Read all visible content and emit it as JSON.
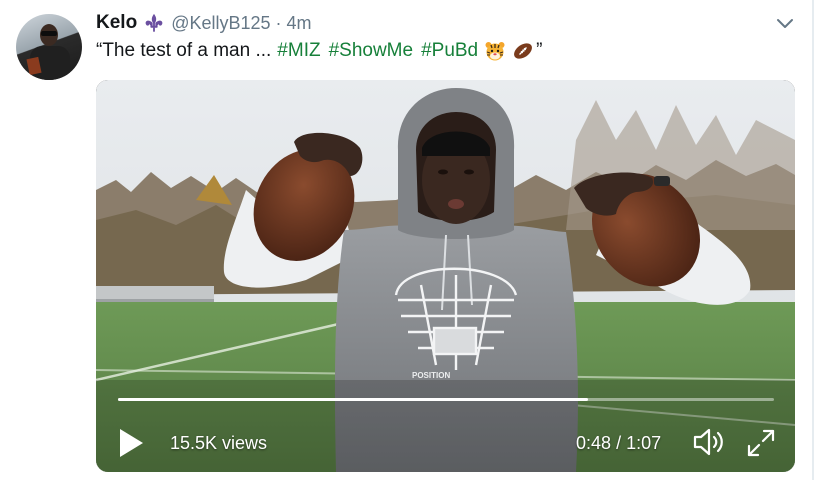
{
  "tweet": {
    "author_name": "Kelo",
    "handle": "@KellyB125",
    "separator": "·",
    "time": "4m",
    "text_open": "“The test of a man ...",
    "hashtags": [
      "#MIZ",
      "#ShowMe",
      "#PuBd"
    ],
    "text_close": "”",
    "emojis": [
      "tiger-face-emoji",
      "american-football-emoji"
    ],
    "badge_icon": "fleur-de-lis-icon",
    "menu_icon": "chevron-down-icon"
  },
  "video": {
    "views": "15.5K views",
    "elapsed": "0:48",
    "time_separator": "/",
    "duration": "1:07",
    "progress_fraction": 0.716,
    "hoodie_print": "POSITION",
    "controls": [
      "play-icon",
      "volume-icon",
      "expand-icon"
    ]
  },
  "colors": {
    "hashtag": "#17803a",
    "muted": "#657786",
    "text": "#14171a",
    "badge": "#6b4fa0"
  }
}
